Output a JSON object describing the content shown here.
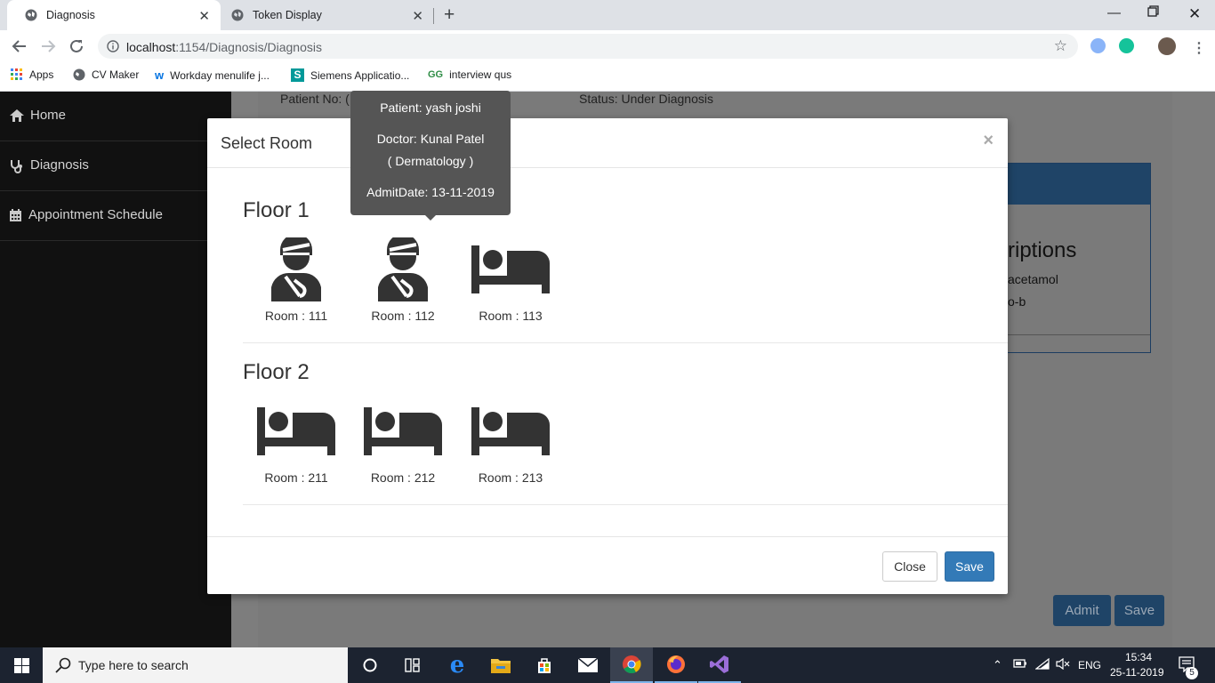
{
  "browser": {
    "tabs": [
      {
        "title": "Diagnosis",
        "active": true
      },
      {
        "title": "Token Display",
        "active": false
      }
    ],
    "address": {
      "host": "localhost",
      "path": ":1154/Diagnosis/Diagnosis"
    },
    "bookmarks": [
      "Apps",
      "CV Maker",
      "Workday menulife j...",
      "Siemens Applicatio...",
      "interview qus"
    ]
  },
  "sidebar": {
    "items": [
      {
        "label": "Home",
        "icon": "home-icon"
      },
      {
        "label": "Diagnosis",
        "icon": "stethoscope-icon"
      },
      {
        "label": "Appointment Schedule",
        "icon": "calendar-icon"
      }
    ]
  },
  "page": {
    "patient_no_label": "Patient No: (",
    "status": "Status: Under Diagnosis",
    "prescriptions_title": "riptions",
    "prescription_items": [
      "acetamol",
      "o-b"
    ],
    "admit_button": "Admit",
    "save_button": "Save"
  },
  "modal": {
    "title": "Select Room",
    "close_symbol": "×",
    "floors": [
      {
        "name": "Floor 1",
        "rooms": [
          {
            "label": "Room : 111",
            "occupied": true
          },
          {
            "label": "Room : 112",
            "occupied": true
          },
          {
            "label": "Room : 113",
            "occupied": false
          }
        ]
      },
      {
        "name": "Floor 2",
        "rooms": [
          {
            "label": "Room : 211",
            "occupied": false
          },
          {
            "label": "Room : 212",
            "occupied": false
          },
          {
            "label": "Room : 213",
            "occupied": false
          }
        ]
      }
    ],
    "close_button": "Close",
    "save_button": "Save"
  },
  "tooltip": {
    "patient": "Patient: yash joshi",
    "doctor": "Doctor: Kunal Patel",
    "department": "( Dermatology )",
    "admit_date": "AdmitDate: 13-11-2019"
  },
  "taskbar": {
    "search_placeholder": "Type here to search",
    "language": "ENG",
    "time": "15:34",
    "date": "25-11-2019",
    "notifications": "5"
  },
  "colors": {
    "primary": "#337ab7",
    "sidebar": "#111111",
    "tooltip": "#555555",
    "room_icon": "#333333"
  }
}
